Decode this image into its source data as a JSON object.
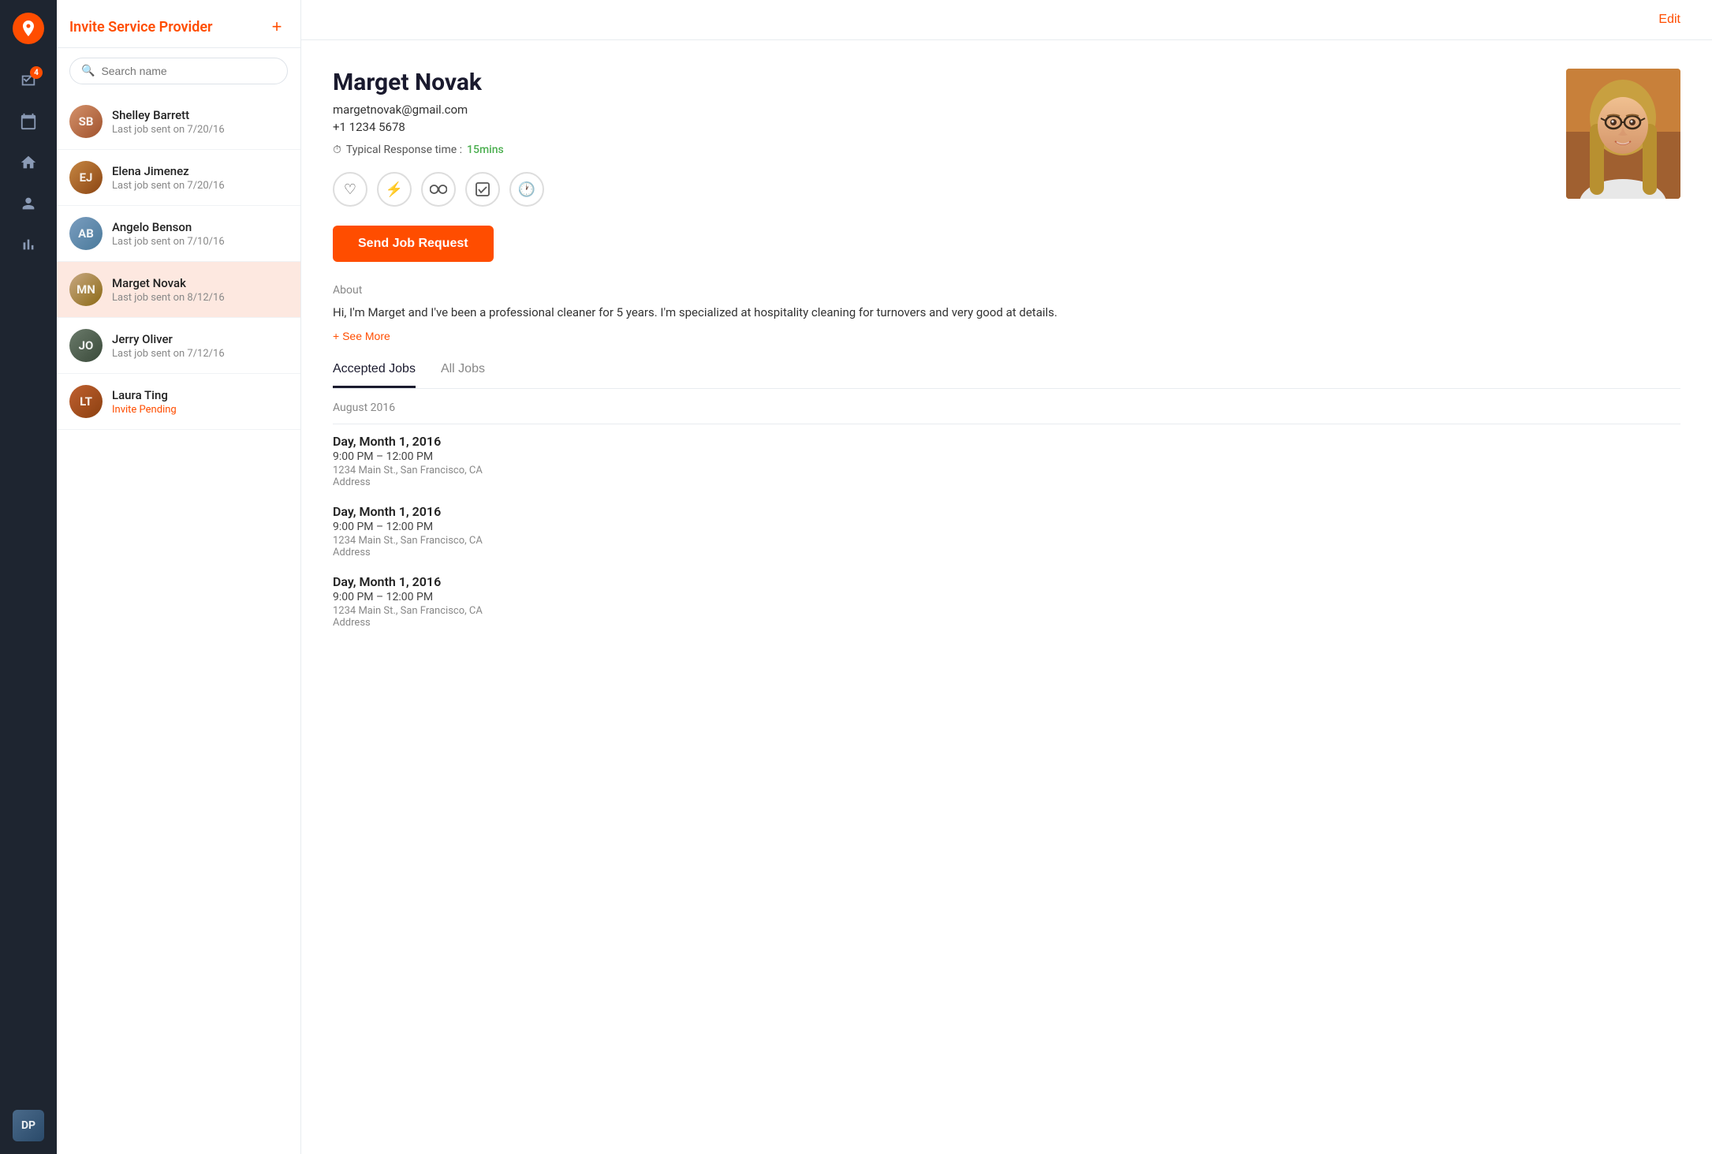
{
  "app": {
    "title": "Invite Service Provider",
    "edit_label": "Edit",
    "add_icon": "+"
  },
  "nav": {
    "badge_count": "4",
    "icons": [
      "location-pin",
      "checkbox-tasks",
      "calendar",
      "home",
      "person",
      "chart"
    ]
  },
  "search": {
    "placeholder": "Search name"
  },
  "providers": [
    {
      "id": "shelley",
      "name": "Shelley Barrett",
      "sub": "Last job sent on 7/20/16",
      "sub_type": "normal",
      "initials": "SB"
    },
    {
      "id": "elena",
      "name": "Elena Jimenez",
      "sub": "Last job sent on 7/20/16",
      "sub_type": "normal",
      "initials": "EJ"
    },
    {
      "id": "angelo",
      "name": "Angelo Benson",
      "sub": "Last job sent on 7/10/16",
      "sub_type": "normal",
      "initials": "AB"
    },
    {
      "id": "marget",
      "name": "Marget Novak",
      "sub": "Last job sent on 8/12/16",
      "sub_type": "normal",
      "initials": "MN",
      "active": true
    },
    {
      "id": "jerry",
      "name": "Jerry Oliver",
      "sub": "Last job sent on 7/12/16",
      "sub_type": "normal",
      "initials": "JO"
    },
    {
      "id": "laura",
      "name": "Laura Ting",
      "sub": "Invite Pending",
      "sub_type": "pending",
      "initials": "LT"
    }
  ],
  "profile": {
    "name": "Marget Novak",
    "email": "margetnovak@gmail.com",
    "phone": "+1 1234 5678",
    "response_label": "Typical Response time :",
    "response_value": "15mins",
    "send_btn": "Send Job Request",
    "about_label": "About",
    "about_text": "Hi, I'm Marget and I've been a professional cleaner for 5 years. I'm specialized at hospitality cleaning for turnovers and very good at details.",
    "see_more": "+ See More",
    "action_icons": [
      "heart",
      "bolt",
      "glasses",
      "checkbox",
      "clock"
    ]
  },
  "tabs": {
    "accepted": "Accepted Jobs",
    "all": "All Jobs",
    "active": "accepted"
  },
  "jobs": {
    "month": "August 2016",
    "items": [
      {
        "date": "Day, Month 1, 2016",
        "time": "9:00 PM – 12:00 PM",
        "address": "1234 Main St., San Francisco, CA",
        "address2": "Address"
      },
      {
        "date": "Day, Month 1, 2016",
        "time": "9:00 PM – 12:00 PM",
        "address": "1234 Main St., San Francisco, CA",
        "address2": "Address"
      },
      {
        "date": "Day, Month 1, 2016",
        "time": "9:00 PM – 12:00 PM",
        "address": "1234 Main St., San Francisco, CA",
        "address2": "Address"
      }
    ]
  }
}
